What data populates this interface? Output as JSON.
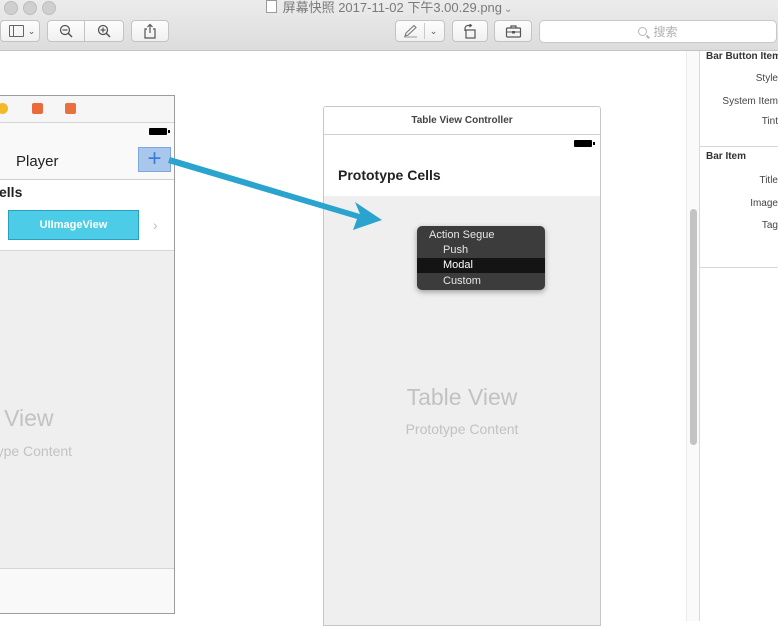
{
  "window": {
    "title": "屏幕快照 2017-11-02 下午3.00.29.png"
  },
  "toolbar": {
    "search_placeholder": "搜索"
  },
  "left_scene": {
    "nav_title": "Player",
    "add_label": "+",
    "cells_label": "ells",
    "image_view_label": "UIImageView",
    "table_view_title": "ble View",
    "table_view_subtitle": "totype Content"
  },
  "right_scene": {
    "header": "Table View Controller",
    "prototype_cells": "Prototype Cells",
    "table_view_title": "Table View",
    "table_view_subtitle": "Prototype Content"
  },
  "segue_menu": {
    "header": "Action Segue",
    "items": [
      {
        "label": "Push",
        "selected": false
      },
      {
        "label": "Modal",
        "selected": true
      },
      {
        "label": "Custom",
        "selected": false
      }
    ]
  },
  "inspector": {
    "section1": "Bar Button Item",
    "section1_fields": [
      "Style",
      "System Item",
      "Tint"
    ],
    "section2": "Bar Item",
    "section2_fields": [
      "Title",
      "Image",
      "Tag"
    ]
  },
  "colors": {
    "segue_arrow": "#2aa4cf",
    "image_view_fill": "#4ccce6",
    "add_button_fill": "#a9c6ec",
    "menu_bg": "#3c3c3c"
  }
}
